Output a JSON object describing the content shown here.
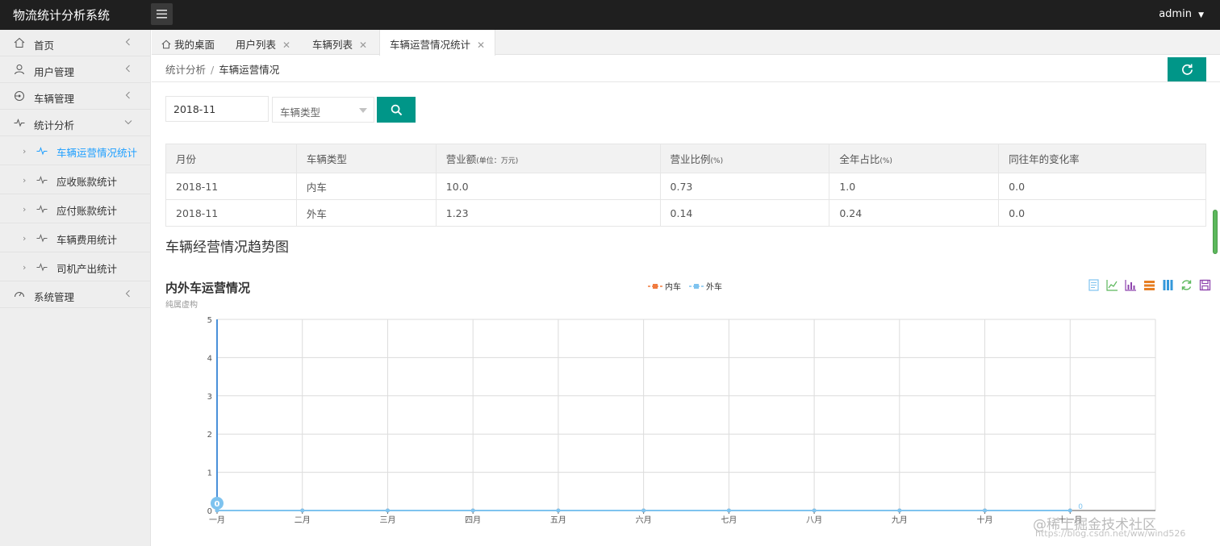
{
  "app": {
    "title": "物流统计分析系统",
    "user": "admin"
  },
  "sidebar": {
    "items": [
      {
        "label": "首页",
        "icon": "home-icon"
      },
      {
        "label": "用户管理",
        "icon": "user-icon"
      },
      {
        "label": "车辆管理",
        "icon": "vehicle-icon"
      },
      {
        "label": "统计分析",
        "icon": "pulse-icon"
      },
      {
        "label": "系统管理",
        "icon": "gauge-icon"
      }
    ],
    "subitems": [
      {
        "label": "车辆运营情况统计",
        "active": true
      },
      {
        "label": "应收账款统计"
      },
      {
        "label": "应付账款统计"
      },
      {
        "label": "车辆费用统计"
      },
      {
        "label": "司机产出统计"
      }
    ]
  },
  "tabs": [
    {
      "label": "我的桌面"
    },
    {
      "label": "用户列表"
    },
    {
      "label": "车辆列表"
    },
    {
      "label": "车辆运营情况统计"
    }
  ],
  "breadcrumb": {
    "parent": "统计分析",
    "sep": "/",
    "current": "车辆运营情况"
  },
  "filters": {
    "month_value": "2018-11",
    "type_placeholder": "车辆类型"
  },
  "table": {
    "headers": [
      "月份",
      "车辆类型",
      "营业额",
      "营业比例",
      "全年占比",
      "同往年的变化率"
    ],
    "header_units": [
      "",
      "",
      "(单位：万元)",
      "(%)",
      "(%)",
      ""
    ],
    "rows": [
      [
        "2018-11",
        "内车",
        "10.0",
        "0.73",
        "1.0",
        "0.0"
      ],
      [
        "2018-11",
        "外车",
        "1.23",
        "0.14",
        "0.24",
        "0.0"
      ]
    ]
  },
  "section_title": "车辆经营情况趋势图",
  "chart_data": {
    "type": "line",
    "title": "内外车运营情况",
    "subtitle": "纯属虚构",
    "categories": [
      "一月",
      "二月",
      "三月",
      "四月",
      "五月",
      "六月",
      "七月",
      "八月",
      "九月",
      "十月",
      "十一月"
    ],
    "series": [
      {
        "name": "内车",
        "color": "#f07b3f",
        "values": [
          0,
          0,
          0,
          0,
          0,
          0,
          0,
          0,
          0,
          0,
          0
        ]
      },
      {
        "name": "外车",
        "color": "#7ec3ef",
        "values": [
          0,
          0,
          0,
          0,
          0,
          0,
          0,
          0,
          0,
          0,
          0
        ]
      }
    ],
    "yticks": [
      "0",
      "1",
      "2",
      "3",
      "4",
      "5"
    ],
    "ylim": [
      0,
      5
    ],
    "point_labels": [
      "0",
      "0"
    ],
    "grid": true,
    "legend": "top-center",
    "toolbox": [
      "data-view-icon",
      "line-icon",
      "bar-icon",
      "stack-icon",
      "tiled-icon",
      "restore-icon",
      "save-image-icon"
    ]
  },
  "watermark": {
    "text": "@稀土掘金技术社区",
    "url": "https://blog.csdn.net/ww/wind526"
  }
}
